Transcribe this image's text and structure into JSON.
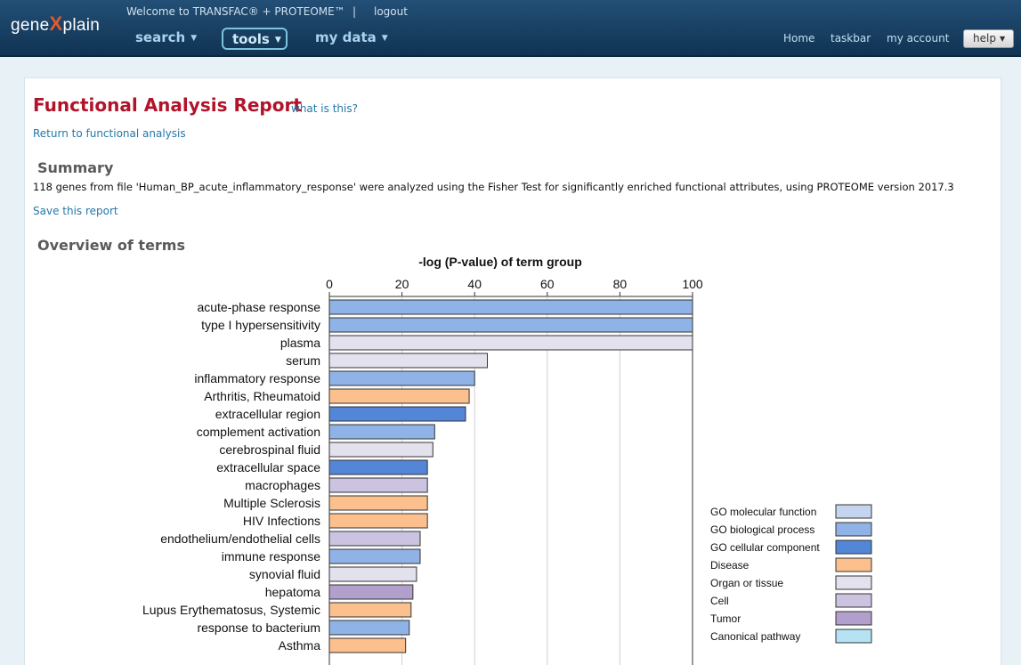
{
  "header": {
    "logo_pre": "gene",
    "logo_x": "X",
    "logo_post": "plain",
    "welcome": "Welcome to TRANSFAC® + PROTEOME™",
    "separator": "|",
    "logout": "logout",
    "menu": [
      {
        "label": "search"
      },
      {
        "label": "tools"
      },
      {
        "label": "my data"
      }
    ],
    "links": [
      {
        "label": "Home"
      },
      {
        "label": "taskbar"
      },
      {
        "label": "my account"
      }
    ],
    "help": "help"
  },
  "page": {
    "title": "Functional Analysis Report",
    "what_is_this": "what is this?",
    "return_link": "Return to functional analysis",
    "summary_heading": "Summary",
    "summary_text": "118 genes from file 'Human_BP_acute_inflammatory_response' were analyzed using the Fisher Test for significantly enriched functional attributes, using PROTEOME version 2017.3",
    "save_link": "Save this report",
    "overview_heading": "Overview of terms"
  },
  "chart_data": {
    "type": "bar",
    "orientation": "horizontal",
    "title": "-log (P-value) of term group",
    "xlim": [
      0,
      100
    ],
    "xticks": [
      0,
      20,
      40,
      60,
      80,
      100
    ],
    "grid": true,
    "categories": [
      "acute-phase response",
      "type I hypersensitivity",
      "plasma",
      "serum",
      "inflammatory response",
      "Arthritis, Rheumatoid",
      "extracellular region",
      "complement activation",
      "cerebrospinal fluid",
      "extracellular space",
      "macrophages",
      "Multiple Sclerosis",
      "HIV Infections",
      "endothelium/endothelial cells",
      "immune response",
      "synovial fluid",
      "hepatoma",
      "Lupus Erythematosus, Systemic",
      "response to bacterium",
      "Asthma"
    ],
    "values": [
      100,
      100,
      100,
      43.5,
      40,
      38.5,
      37.5,
      29,
      28.5,
      27,
      27,
      27,
      27,
      25,
      25,
      24,
      23,
      22.5,
      22,
      21
    ],
    "groups": [
      "GO biological process",
      "GO biological process",
      "Organ or tissue",
      "Organ or tissue",
      "GO biological process",
      "Disease",
      "GO cellular component",
      "GO biological process",
      "Organ or tissue",
      "GO cellular component",
      "Cell",
      "Disease",
      "Disease",
      "Cell",
      "GO biological process",
      "Organ or tissue",
      "Tumor",
      "Disease",
      "GO biological process",
      "Disease"
    ],
    "legend": [
      {
        "name": "GO molecular function",
        "color": "#c5d5ef"
      },
      {
        "name": "GO biological process",
        "color": "#8fb3e6"
      },
      {
        "name": "GO cellular component",
        "color": "#5386d6"
      },
      {
        "name": "Disease",
        "color": "#fbc08e"
      },
      {
        "name": "Organ or tissue",
        "color": "#e4e1ee"
      },
      {
        "name": "Cell",
        "color": "#cbc3e0"
      },
      {
        "name": "Tumor",
        "color": "#b0a0cb"
      },
      {
        "name": "Canonical pathway",
        "color": "#b5e3f4"
      }
    ],
    "legend_position": "bottom-right"
  }
}
